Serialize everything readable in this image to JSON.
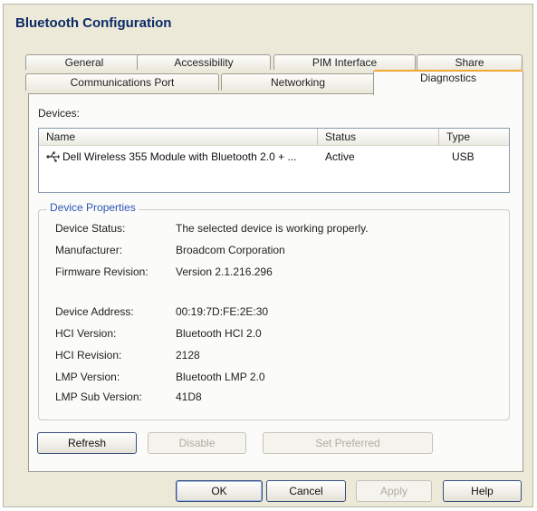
{
  "window": {
    "title": "Bluetooth Configuration"
  },
  "tabs": {
    "row1": [
      "General",
      "Accessibility",
      "PIM Interface",
      "Share"
    ],
    "row2": [
      "Communications Port",
      "Networking",
      "Diagnostics"
    ],
    "active": "Diagnostics"
  },
  "devices": {
    "label": "Devices:",
    "columns": [
      "Name",
      "Status",
      "Type"
    ],
    "rows": [
      {
        "icon": "usb-icon",
        "name": "Dell Wireless 355 Module with Bluetooth 2.0 + ...",
        "status": "Active",
        "type": "USB"
      }
    ]
  },
  "properties": {
    "title": "Device Properties",
    "items": [
      {
        "label": "Device Status:",
        "value": "The selected device is working properly."
      },
      {
        "label": "Manufacturer:",
        "value": "Broadcom Corporation"
      },
      {
        "label": "Firmware Revision:",
        "value": "Version 2.1.216.296"
      },
      {
        "label": "Device Address:",
        "value": "00:19:7D:FE:2E:30"
      },
      {
        "label": "HCI Version:",
        "value": "Bluetooth HCI 2.0"
      },
      {
        "label": "HCI Revision:",
        "value": "2128"
      },
      {
        "label": "LMP Version:",
        "value": "Bluetooth LMP 2.0"
      },
      {
        "label": "LMP Sub Version:",
        "value": "41D8"
      }
    ]
  },
  "panel_buttons": {
    "refresh": "Refresh",
    "disable": "Disable",
    "set_preferred": "Set Preferred"
  },
  "dialog_buttons": {
    "ok": "OK",
    "cancel": "Cancel",
    "apply": "Apply",
    "help": "Help"
  }
}
